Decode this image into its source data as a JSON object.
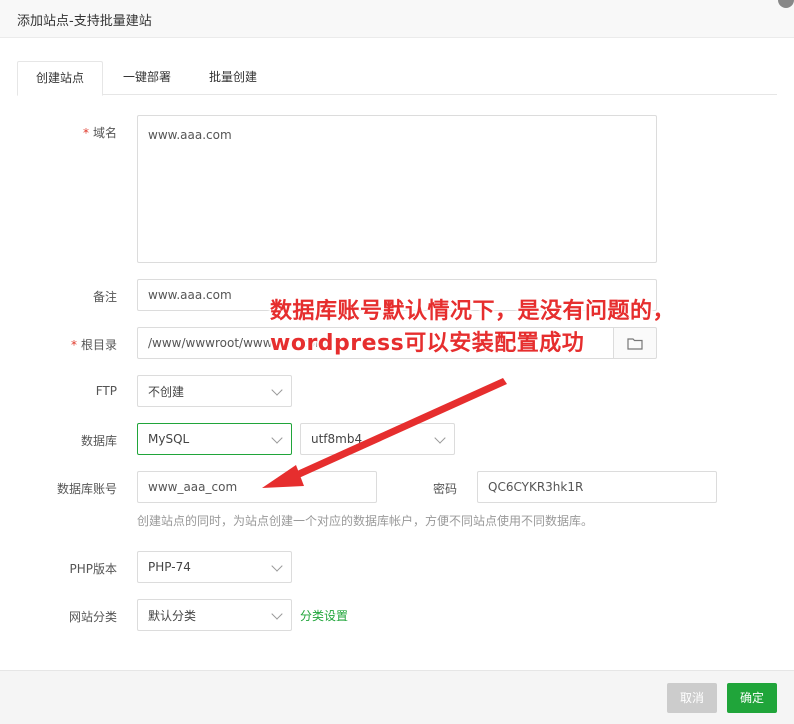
{
  "window": {
    "title": "添加站点-支持批量建站"
  },
  "tabs": [
    {
      "label": "创建站点",
      "active": true
    },
    {
      "label": "一键部署",
      "active": false
    },
    {
      "label": "批量创建",
      "active": false
    }
  ],
  "form": {
    "domain": {
      "label": "域名",
      "required_mark": "*",
      "value": "www.aaa.com"
    },
    "remark": {
      "label": "备注",
      "value": "www.aaa.com"
    },
    "root": {
      "label": "根目录",
      "required_mark": "*",
      "value": "/www/wwwroot/www.aaa.com"
    },
    "ftp": {
      "label": "FTP",
      "value": "不创建"
    },
    "database": {
      "label": "数据库",
      "type_value": "MySQL",
      "charset_value": "utf8mb4"
    },
    "db_account": {
      "label": "数据库账号",
      "value": "www_aaa_com",
      "password_label": "密码",
      "password_value": "QC6CYKR3hk1R"
    },
    "db_hint": "创建站点的同时，为站点创建一个对应的数据库帐户，方便不同站点使用不同数据库。",
    "php": {
      "label": "PHP版本",
      "value": "PHP-74"
    },
    "category": {
      "label": "网站分类",
      "value": "默认分类",
      "link": "分类设置"
    }
  },
  "annotation": {
    "line1": "数据库账号默认情况下，是没有问题的，",
    "line2": "wordpress可以安装配置成功",
    "color": "#e62e2e"
  },
  "footer": {
    "cancel_label": "取消",
    "ok_label": "确定"
  },
  "colors": {
    "accent": "#20a53a",
    "annotation": "#e62e2e"
  },
  "icons": {
    "folder": "folder-icon",
    "chevron": "chevron-down-icon"
  }
}
